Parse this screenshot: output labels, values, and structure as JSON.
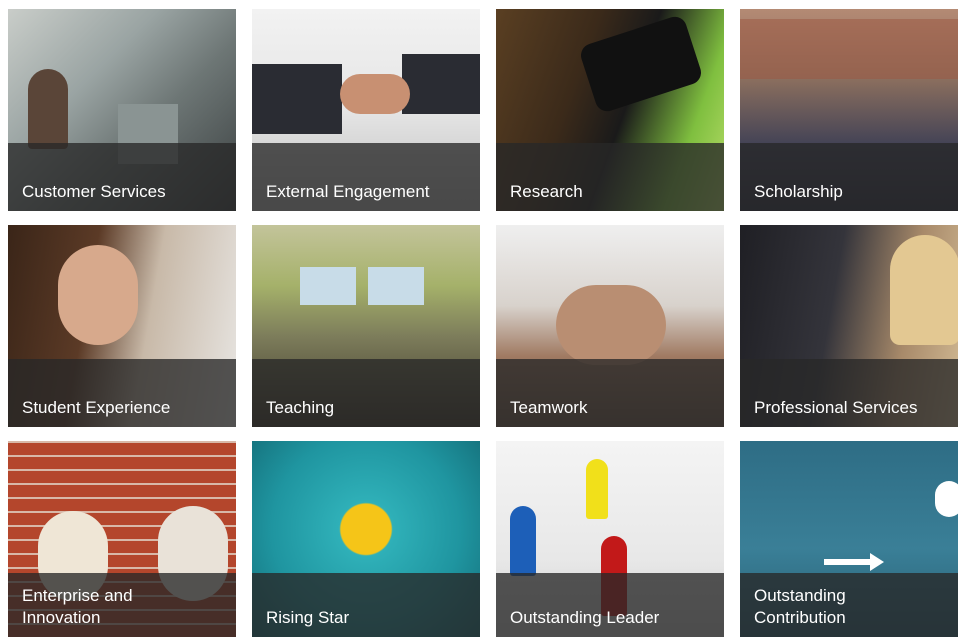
{
  "tiles": [
    {
      "id": "customer-services",
      "label": "Customer Services",
      "icon": "people-at-desk-photo"
    },
    {
      "id": "external-engagement",
      "label": "External Engagement",
      "icon": "handshake-photo"
    },
    {
      "id": "research",
      "label": "Research",
      "icon": "vr-headset-photo"
    },
    {
      "id": "scholarship",
      "label": "Scholarship",
      "icon": "crowd-walking-photo"
    },
    {
      "id": "student-experience",
      "label": "Student Experience",
      "icon": "student-smiling-photo"
    },
    {
      "id": "teaching",
      "label": "Teaching",
      "icon": "lecture-hall-photo"
    },
    {
      "id": "teamwork",
      "label": "Teamwork",
      "icon": "stacked-hands-photo"
    },
    {
      "id": "professional-services",
      "label": "Professional Services",
      "icon": "office-colleagues-photo"
    },
    {
      "id": "enterprise-innovation",
      "label": "Enterprise and\nInnovation",
      "icon": "bulb-heads-photo"
    },
    {
      "id": "rising-star",
      "label": "Rising Star",
      "icon": "smiley-balls-photo"
    },
    {
      "id": "outstanding-leader",
      "label": "Outstanding Leader",
      "icon": "game-pieces-photo"
    },
    {
      "id": "outstanding-contribution",
      "label": "Outstanding\nContribution",
      "icon": "lightbulb-silhouettes-photo"
    }
  ]
}
